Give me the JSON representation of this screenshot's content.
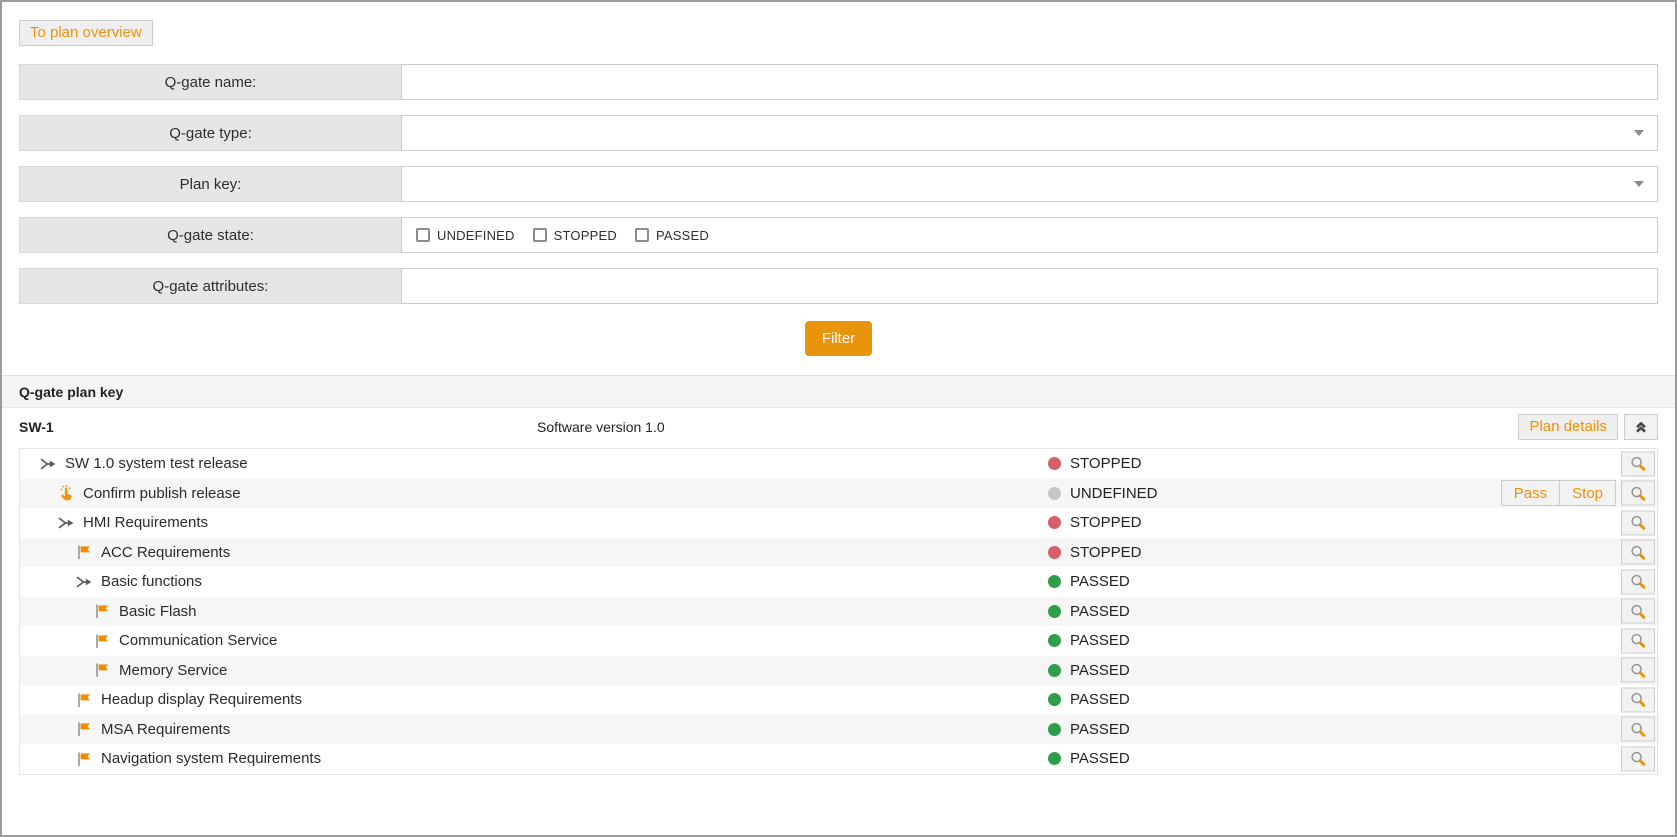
{
  "toolbar": {
    "to_plan_overview_label": "To plan overview"
  },
  "filter_form": {
    "rows": [
      {
        "label": "Q-gate name:",
        "type": "text"
      },
      {
        "label": "Q-gate type:",
        "type": "select",
        "selected_value": ""
      },
      {
        "label": "Plan key:",
        "type": "select",
        "selected_value": ""
      },
      {
        "label": "Q-gate state:",
        "type": "checkboxes",
        "options": [
          "UNDEFINED",
          "STOPPED",
          "PASSED"
        ],
        "checked": [
          false,
          false,
          false
        ]
      },
      {
        "label": "Q-gate attributes:",
        "type": "text"
      }
    ],
    "filter_button_label": "Filter"
  },
  "plan_section": {
    "header": "Q-gate plan key",
    "plan": {
      "key": "SW-1",
      "description": "Software version 1.0",
      "plan_details_button_label": "Plan details",
      "collapse_icon": "double-chevron-up-icon"
    },
    "qgates": [
      {
        "name": "SW 1.0 system test release",
        "icon": "junction-arrow",
        "level": 0,
        "state": "STOPPED"
      },
      {
        "name": "Confirm publish release",
        "icon": "confirm-hand",
        "level": 1,
        "state": "UNDEFINED",
        "actions": [
          "Pass",
          "Stop"
        ]
      },
      {
        "name": "HMI Requirements",
        "icon": "junction-arrow",
        "level": 1,
        "state": "STOPPED"
      },
      {
        "name": "ACC Requirements",
        "icon": "milestone-flag",
        "level": 2,
        "state": "STOPPED"
      },
      {
        "name": "Basic functions",
        "icon": "junction-arrow",
        "level": 2,
        "state": "PASSED"
      },
      {
        "name": "Basic Flash",
        "icon": "milestone-flag",
        "level": 3,
        "state": "PASSED"
      },
      {
        "name": "Communication Service",
        "icon": "milestone-flag",
        "level": 3,
        "state": "PASSED"
      },
      {
        "name": "Memory Service",
        "icon": "milestone-flag",
        "level": 3,
        "state": "PASSED"
      },
      {
        "name": "Headup display Requirements",
        "icon": "milestone-flag",
        "level": 2,
        "state": "PASSED"
      },
      {
        "name": "MSA Requirements",
        "icon": "milestone-flag",
        "level": 2,
        "state": "PASSED"
      },
      {
        "name": "Navigation system Requirements",
        "icon": "milestone-flag",
        "level": 2,
        "state": "PASSED"
      }
    ],
    "row_action_icon": "magnifier-icon"
  },
  "colors": {
    "accent_orange_text": "#EE9008",
    "accent_orange_button": "#E8940C",
    "state_stopped": "#D75F6A",
    "state_passed": "#2F9E49",
    "state_undefined": "#C6C6C6"
  }
}
